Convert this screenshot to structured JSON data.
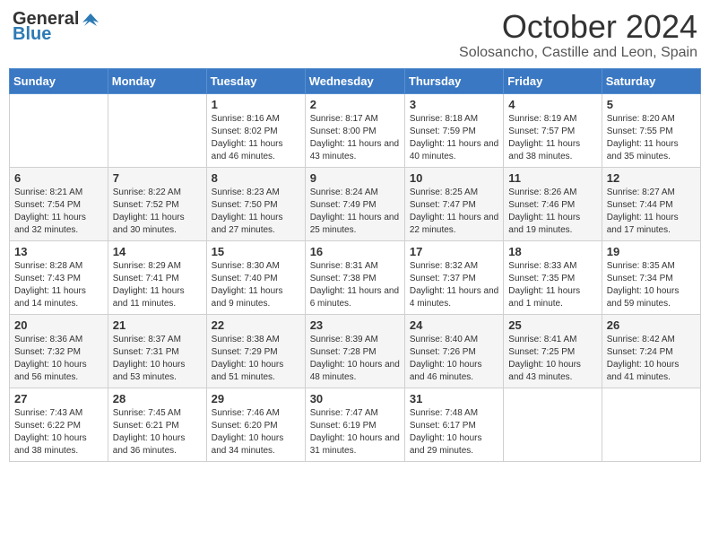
{
  "header": {
    "logo_general": "General",
    "logo_blue": "Blue",
    "month": "October 2024",
    "location": "Solosancho, Castille and Leon, Spain"
  },
  "weekdays": [
    "Sunday",
    "Monday",
    "Tuesday",
    "Wednesday",
    "Thursday",
    "Friday",
    "Saturday"
  ],
  "weeks": [
    [
      {
        "day": "",
        "sunrise": "",
        "sunset": "",
        "daylight": ""
      },
      {
        "day": "",
        "sunrise": "",
        "sunset": "",
        "daylight": ""
      },
      {
        "day": "1",
        "sunrise": "Sunrise: 8:16 AM",
        "sunset": "Sunset: 8:02 PM",
        "daylight": "Daylight: 11 hours and 46 minutes."
      },
      {
        "day": "2",
        "sunrise": "Sunrise: 8:17 AM",
        "sunset": "Sunset: 8:00 PM",
        "daylight": "Daylight: 11 hours and 43 minutes."
      },
      {
        "day": "3",
        "sunrise": "Sunrise: 8:18 AM",
        "sunset": "Sunset: 7:59 PM",
        "daylight": "Daylight: 11 hours and 40 minutes."
      },
      {
        "day": "4",
        "sunrise": "Sunrise: 8:19 AM",
        "sunset": "Sunset: 7:57 PM",
        "daylight": "Daylight: 11 hours and 38 minutes."
      },
      {
        "day": "5",
        "sunrise": "Sunrise: 8:20 AM",
        "sunset": "Sunset: 7:55 PM",
        "daylight": "Daylight: 11 hours and 35 minutes."
      }
    ],
    [
      {
        "day": "6",
        "sunrise": "Sunrise: 8:21 AM",
        "sunset": "Sunset: 7:54 PM",
        "daylight": "Daylight: 11 hours and 32 minutes."
      },
      {
        "day": "7",
        "sunrise": "Sunrise: 8:22 AM",
        "sunset": "Sunset: 7:52 PM",
        "daylight": "Daylight: 11 hours and 30 minutes."
      },
      {
        "day": "8",
        "sunrise": "Sunrise: 8:23 AM",
        "sunset": "Sunset: 7:50 PM",
        "daylight": "Daylight: 11 hours and 27 minutes."
      },
      {
        "day": "9",
        "sunrise": "Sunrise: 8:24 AM",
        "sunset": "Sunset: 7:49 PM",
        "daylight": "Daylight: 11 hours and 25 minutes."
      },
      {
        "day": "10",
        "sunrise": "Sunrise: 8:25 AM",
        "sunset": "Sunset: 7:47 PM",
        "daylight": "Daylight: 11 hours and 22 minutes."
      },
      {
        "day": "11",
        "sunrise": "Sunrise: 8:26 AM",
        "sunset": "Sunset: 7:46 PM",
        "daylight": "Daylight: 11 hours and 19 minutes."
      },
      {
        "day": "12",
        "sunrise": "Sunrise: 8:27 AM",
        "sunset": "Sunset: 7:44 PM",
        "daylight": "Daylight: 11 hours and 17 minutes."
      }
    ],
    [
      {
        "day": "13",
        "sunrise": "Sunrise: 8:28 AM",
        "sunset": "Sunset: 7:43 PM",
        "daylight": "Daylight: 11 hours and 14 minutes."
      },
      {
        "day": "14",
        "sunrise": "Sunrise: 8:29 AM",
        "sunset": "Sunset: 7:41 PM",
        "daylight": "Daylight: 11 hours and 11 minutes."
      },
      {
        "day": "15",
        "sunrise": "Sunrise: 8:30 AM",
        "sunset": "Sunset: 7:40 PM",
        "daylight": "Daylight: 11 hours and 9 minutes."
      },
      {
        "day": "16",
        "sunrise": "Sunrise: 8:31 AM",
        "sunset": "Sunset: 7:38 PM",
        "daylight": "Daylight: 11 hours and 6 minutes."
      },
      {
        "day": "17",
        "sunrise": "Sunrise: 8:32 AM",
        "sunset": "Sunset: 7:37 PM",
        "daylight": "Daylight: 11 hours and 4 minutes."
      },
      {
        "day": "18",
        "sunrise": "Sunrise: 8:33 AM",
        "sunset": "Sunset: 7:35 PM",
        "daylight": "Daylight: 11 hours and 1 minute."
      },
      {
        "day": "19",
        "sunrise": "Sunrise: 8:35 AM",
        "sunset": "Sunset: 7:34 PM",
        "daylight": "Daylight: 10 hours and 59 minutes."
      }
    ],
    [
      {
        "day": "20",
        "sunrise": "Sunrise: 8:36 AM",
        "sunset": "Sunset: 7:32 PM",
        "daylight": "Daylight: 10 hours and 56 minutes."
      },
      {
        "day": "21",
        "sunrise": "Sunrise: 8:37 AM",
        "sunset": "Sunset: 7:31 PM",
        "daylight": "Daylight: 10 hours and 53 minutes."
      },
      {
        "day": "22",
        "sunrise": "Sunrise: 8:38 AM",
        "sunset": "Sunset: 7:29 PM",
        "daylight": "Daylight: 10 hours and 51 minutes."
      },
      {
        "day": "23",
        "sunrise": "Sunrise: 8:39 AM",
        "sunset": "Sunset: 7:28 PM",
        "daylight": "Daylight: 10 hours and 48 minutes."
      },
      {
        "day": "24",
        "sunrise": "Sunrise: 8:40 AM",
        "sunset": "Sunset: 7:26 PM",
        "daylight": "Daylight: 10 hours and 46 minutes."
      },
      {
        "day": "25",
        "sunrise": "Sunrise: 8:41 AM",
        "sunset": "Sunset: 7:25 PM",
        "daylight": "Daylight: 10 hours and 43 minutes."
      },
      {
        "day": "26",
        "sunrise": "Sunrise: 8:42 AM",
        "sunset": "Sunset: 7:24 PM",
        "daylight": "Daylight: 10 hours and 41 minutes."
      }
    ],
    [
      {
        "day": "27",
        "sunrise": "Sunrise: 7:43 AM",
        "sunset": "Sunset: 6:22 PM",
        "daylight": "Daylight: 10 hours and 38 minutes."
      },
      {
        "day": "28",
        "sunrise": "Sunrise: 7:45 AM",
        "sunset": "Sunset: 6:21 PM",
        "daylight": "Daylight: 10 hours and 36 minutes."
      },
      {
        "day": "29",
        "sunrise": "Sunrise: 7:46 AM",
        "sunset": "Sunset: 6:20 PM",
        "daylight": "Daylight: 10 hours and 34 minutes."
      },
      {
        "day": "30",
        "sunrise": "Sunrise: 7:47 AM",
        "sunset": "Sunset: 6:19 PM",
        "daylight": "Daylight: 10 hours and 31 minutes."
      },
      {
        "day": "31",
        "sunrise": "Sunrise: 7:48 AM",
        "sunset": "Sunset: 6:17 PM",
        "daylight": "Daylight: 10 hours and 29 minutes."
      },
      {
        "day": "",
        "sunrise": "",
        "sunset": "",
        "daylight": ""
      },
      {
        "day": "",
        "sunrise": "",
        "sunset": "",
        "daylight": ""
      }
    ]
  ]
}
